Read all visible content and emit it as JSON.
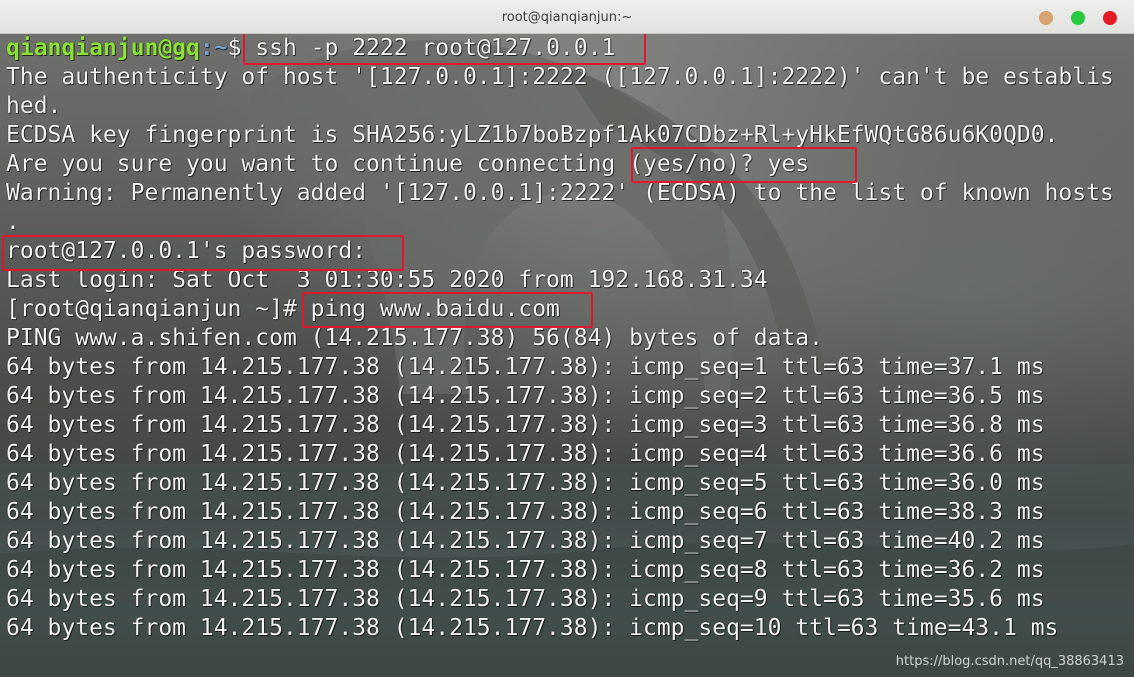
{
  "window": {
    "title": "root@qianqianjun:~"
  },
  "terminal": {
    "prompt": {
      "user_host": "qianqianjun@gq",
      "path": ":~",
      "dollar": "$ "
    },
    "lines": [
      "ssh -p 2222 root@127.0.0.1",
      "The authenticity of host '[127.0.0.1]:2222 ([127.0.0.1]:2222)' can't be establis",
      "hed.",
      "ECDSA key fingerprint is SHA256:yLZ1b7boBzpf1Ak07CDbz+Rl+yHkEfWQtG86u6K0QD0.",
      "Are you sure you want to continue connecting (yes/no)? yes",
      "Warning: Permanently added '[127.0.0.1]:2222' (ECDSA) to the list of known hosts",
      ".",
      "root@127.0.0.1's password:",
      "Last login: Sat Oct  3 01:30:55 2020 from 192.168.31.34",
      "[root@qianqianjun ~]# ping www.baidu.com",
      "PING www.a.shifen.com (14.215.177.38) 56(84) bytes of data.",
      "64 bytes from 14.215.177.38 (14.215.177.38): icmp_seq=1 ttl=63 time=37.1 ms",
      "64 bytes from 14.215.177.38 (14.215.177.38): icmp_seq=2 ttl=63 time=36.5 ms",
      "64 bytes from 14.215.177.38 (14.215.177.38): icmp_seq=3 ttl=63 time=36.8 ms",
      "64 bytes from 14.215.177.38 (14.215.177.38): icmp_seq=4 ttl=63 time=36.6 ms",
      "64 bytes from 14.215.177.38 (14.215.177.38): icmp_seq=5 ttl=63 time=36.0 ms",
      "64 bytes from 14.215.177.38 (14.215.177.38): icmp_seq=6 ttl=63 time=38.3 ms",
      "64 bytes from 14.215.177.38 (14.215.177.38): icmp_seq=7 ttl=63 time=40.2 ms",
      "64 bytes from 14.215.177.38 (14.215.177.38): icmp_seq=8 ttl=63 time=36.2 ms",
      "64 bytes from 14.215.177.38 (14.215.177.38): icmp_seq=9 ttl=63 time=35.6 ms",
      "64 bytes from 14.215.177.38 (14.215.177.38): icmp_seq=10 ttl=63 time=43.1 ms"
    ]
  },
  "watermark": "https://blog.csdn.net/qq_38863413",
  "colors": {
    "highlight": "#e0182d",
    "prompt_user": "#8ae234",
    "prompt_path": "#729fcf"
  }
}
